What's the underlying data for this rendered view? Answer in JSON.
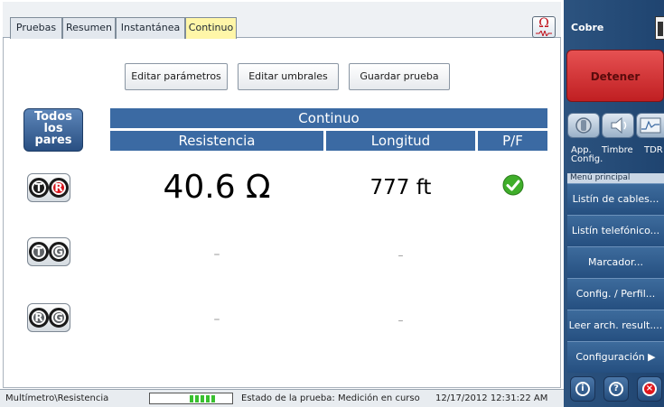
{
  "tabs": [
    {
      "label": "Pruebas",
      "active": false
    },
    {
      "label": "Resumen",
      "active": false
    },
    {
      "label": "Instantánea",
      "active": false
    },
    {
      "label": "Continuo",
      "active": true
    }
  ],
  "header_icon": {
    "symbol": "Ω",
    "name": "ohm-meter-icon"
  },
  "actions": {
    "editar_parametros": "Editar parámetros",
    "editar_umbrales": "Editar umbrales",
    "guardar_prueba": "Guardar prueba"
  },
  "pairs_button": {
    "line1": "Todos",
    "line2": "los",
    "line3": "pares"
  },
  "table": {
    "title": "Continuo",
    "columns": {
      "resistencia": "Resistencia",
      "longitud": "Longitud",
      "pf": "P/F"
    },
    "rows": [
      {
        "pair": [
          "T",
          "R"
        ],
        "resistencia": "40.6 Ω",
        "longitud": "777 ft",
        "pf": "pass"
      },
      {
        "pair": [
          "T",
          "G"
        ],
        "resistencia": "–",
        "longitud": "–",
        "pf": ""
      },
      {
        "pair": [
          "R",
          "G"
        ],
        "resistencia": "–",
        "longitud": "–",
        "pf": ""
      }
    ]
  },
  "status": {
    "path": "Multímetro\\Resistencia",
    "progress_segments": 5,
    "estado": "Estado de la prueba: Medición en curso",
    "time": "12/17/2012 12:31:22 AM"
  },
  "sidebar": {
    "title": "Cobre",
    "detener": "Detener",
    "apps": {
      "app": "App.",
      "config": "Config.",
      "timbre": "Timbre",
      "tdr": "TDR"
    },
    "menu_header": "Menú principal",
    "menu_items": [
      "Listín de cables...",
      "Listín telefónico...",
      "Marcador...",
      "Config. / Perfil...",
      "Leer arch. result....",
      "Configuración ▶"
    ],
    "bottom_buttons": {
      "info": "i",
      "help": "?",
      "close": "×"
    }
  },
  "colors": {
    "header_blue": "#3b6aa3",
    "active_tab": "#fff6a8",
    "detener_red": "#d9383a",
    "pass_green": "#3fae2a",
    "sidebar_blue": "#254f80"
  }
}
